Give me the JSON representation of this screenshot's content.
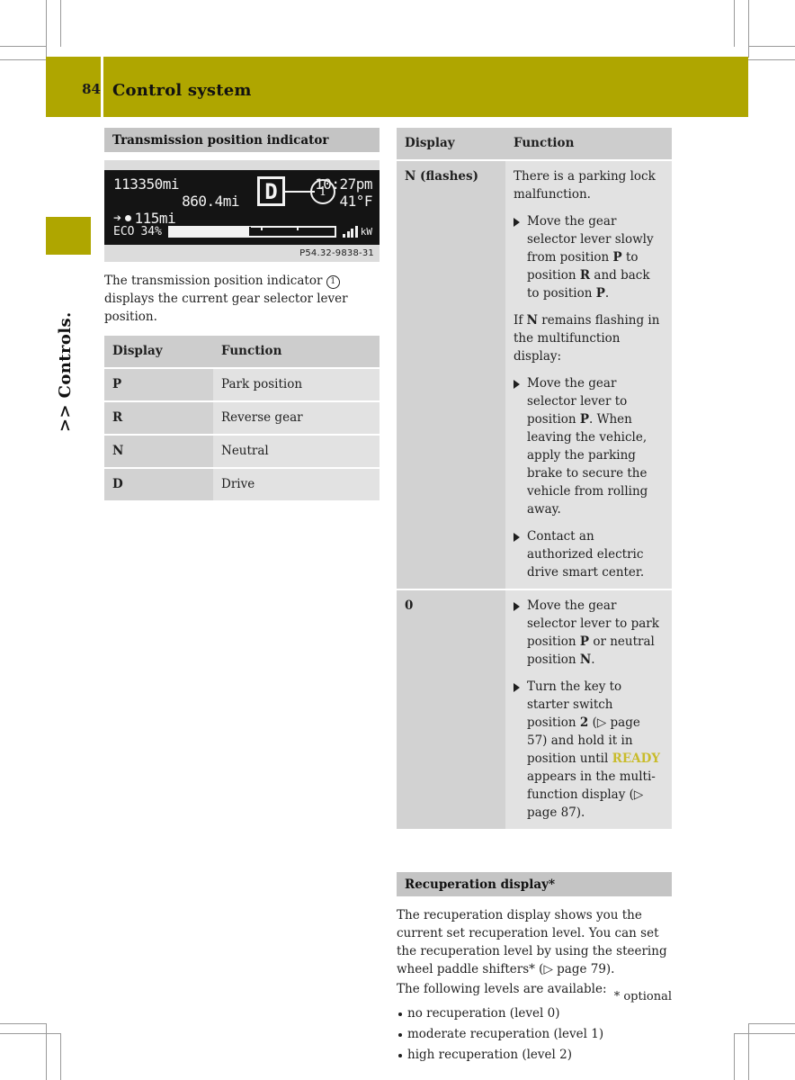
{
  "header": {
    "page_number": "84",
    "title": "Control system",
    "accent_color": "#afa600"
  },
  "side_tab": {
    "label": ">> Controls."
  },
  "left_column": {
    "section_title": "Transmission position indicator",
    "figure": {
      "caption": "P54.32-9838-31",
      "cluster": {
        "odometer": "113350mi",
        "trip": "860.4mi",
        "range": "115mi",
        "gear": "D",
        "callout": "1",
        "time": "10:27pm",
        "temperature": "41°F",
        "eco_label": "ECO",
        "eco_value": "34%",
        "power_unit": "kW"
      }
    },
    "intro_before": "The transmission position indicator ",
    "intro_marker": "1",
    "intro_after": " displays the current gear selector lever position.",
    "table": {
      "headers": [
        "Display",
        "Function"
      ],
      "rows": [
        {
          "display": "P",
          "function": "Park position"
        },
        {
          "display": "R",
          "function": "Reverse gear"
        },
        {
          "display": "N",
          "function": "Neutral"
        },
        {
          "display": "D",
          "function": "Drive"
        }
      ]
    }
  },
  "right_column": {
    "table": {
      "headers": [
        "Display",
        "Function"
      ],
      "rows": [
        {
          "display": "N (flashes)",
          "blocks": [
            {
              "kind": "para",
              "text": "There is a parking lock malfunction."
            },
            {
              "kind": "step",
              "html": "Move the gear selector lever slowly from position <b>P</b> to position <b>R</b> and back to position <b>P</b>."
            },
            {
              "kind": "para",
              "html": "If <b>N</b> remains flashing in the multifunction display:"
            },
            {
              "kind": "step",
              "html": "Move the gear selector lever to position <b>P</b>. When leaving the vehicle, apply the parking brake to secure the vehicle from rolling away."
            },
            {
              "kind": "step",
              "html": "Contact an authorized electric drive smart center."
            }
          ]
        },
        {
          "display": "0",
          "blocks": [
            {
              "kind": "step",
              "html": "Move the gear selector lever to park position <b>P</b> or neutral position <b>N</b>."
            },
            {
              "kind": "step",
              "html": "Turn the key to starter switch position <b>2</b> (&#9655; page 57) and hold it in position until <span class=\"ready\">READY</span> appears in the multi-function display (&#9655; page 87)."
            }
          ]
        }
      ]
    },
    "recuperation": {
      "section_title": "Recuperation display*",
      "paragraph1": "The recuperation display shows you the current set recuperation level. You can set the recuperation level by using the steering wheel paddle shifters* (▷ page 79).",
      "paragraph2": "The following levels are available:",
      "levels": [
        "no recuperation (level 0)",
        "moderate recuperation (level 1)",
        "high recuperation (level 2)"
      ]
    }
  },
  "footnote": "* optional"
}
